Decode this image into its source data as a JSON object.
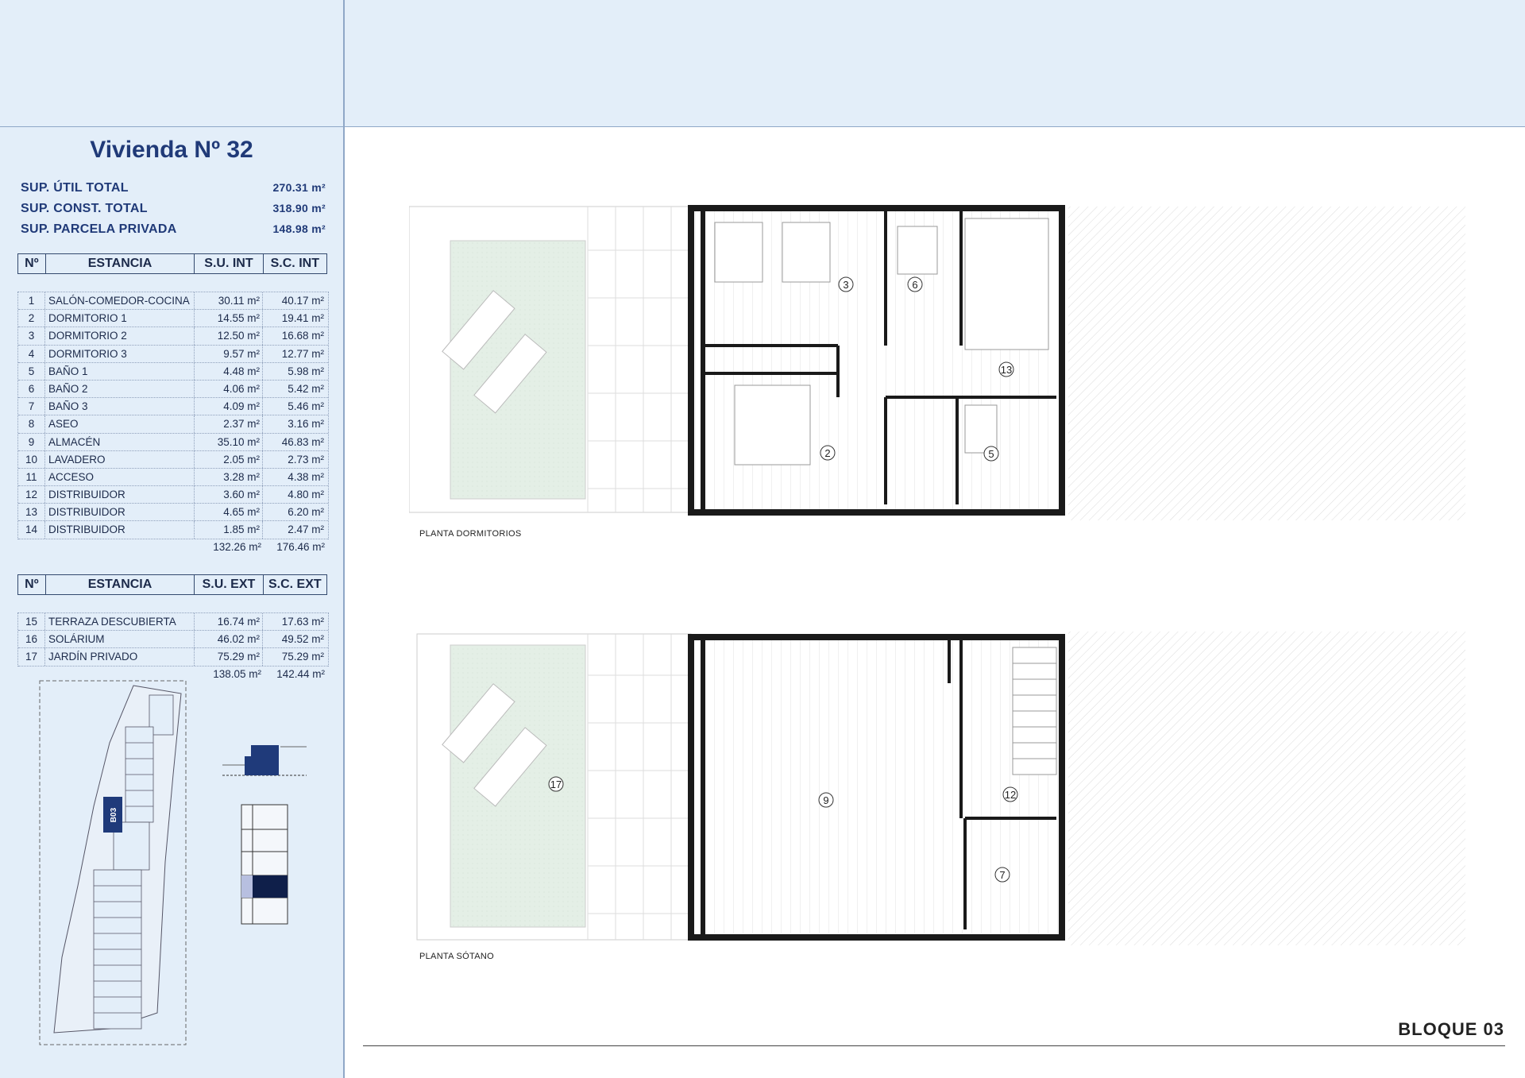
{
  "title": "Vivienda Nº 32",
  "summary": [
    {
      "label": "SUP. ÚTIL TOTAL",
      "value": "270.31 m²"
    },
    {
      "label": "SUP. CONST. TOTAL",
      "value": "318.90 m²"
    },
    {
      "label": "SUP. PARCELA PRIVADA",
      "value": "148.98 m²"
    }
  ],
  "int_table": {
    "headers": [
      "Nº",
      "ESTANCIA",
      "S.U. INT",
      "S.C. INT"
    ],
    "rows": [
      {
        "n": "1",
        "name": "SALÓN-COMEDOR-COCINA",
        "su": "30.11 m²",
        "sc": "40.17 m²"
      },
      {
        "n": "2",
        "name": "DORMITORIO 1",
        "su": "14.55 m²",
        "sc": "19.41 m²"
      },
      {
        "n": "3",
        "name": "DORMITORIO 2",
        "su": "12.50 m²",
        "sc": "16.68 m²"
      },
      {
        "n": "4",
        "name": "DORMITORIO 3",
        "su": "9.57 m²",
        "sc": "12.77 m²"
      },
      {
        "n": "5",
        "name": "BAÑO 1",
        "su": "4.48 m²",
        "sc": "5.98 m²"
      },
      {
        "n": "6",
        "name": "BAÑO 2",
        "su": "4.06 m²",
        "sc": "5.42 m²"
      },
      {
        "n": "7",
        "name": "BAÑO 3",
        "su": "4.09 m²",
        "sc": "5.46 m²"
      },
      {
        "n": "8",
        "name": "ASEO",
        "su": "2.37 m²",
        "sc": "3.16 m²"
      },
      {
        "n": "9",
        "name": "ALMACÉN",
        "su": "35.10 m²",
        "sc": "46.83 m²"
      },
      {
        "n": "10",
        "name": "LAVADERO",
        "su": "2.05 m²",
        "sc": "2.73 m²"
      },
      {
        "n": "11",
        "name": "ACCESO",
        "su": "3.28 m²",
        "sc": "4.38 m²"
      },
      {
        "n": "12",
        "name": "DISTRIBUIDOR",
        "su": "3.60 m²",
        "sc": "4.80 m²"
      },
      {
        "n": "13",
        "name": "DISTRIBUIDOR",
        "su": "4.65 m²",
        "sc": "6.20 m²"
      },
      {
        "n": "14",
        "name": "DISTRIBUIDOR",
        "su": "1.85 m²",
        "sc": "2.47 m²"
      }
    ],
    "total_su": "132.26 m²",
    "total_sc": "176.46 m²"
  },
  "ext_table": {
    "headers": [
      "Nº",
      "ESTANCIA",
      "S.U. EXT",
      "S.C. EXT"
    ],
    "rows": [
      {
        "n": "15",
        "name": "TERRAZA DESCUBIERTA",
        "su": "16.74 m²",
        "sc": "17.63 m²"
      },
      {
        "n": "16",
        "name": "SOLÁRIUM",
        "su": "46.02 m²",
        "sc": "49.52 m²"
      },
      {
        "n": "17",
        "name": "JARDÍN PRIVADO",
        "su": "75.29 m²",
        "sc": "75.29 m²"
      }
    ],
    "total_su": "138.05 m²",
    "total_sc": "142.44 m²"
  },
  "site_plan": {
    "block_label": "B03"
  },
  "plans": {
    "upper_label": "PLANTA DORMITORIOS",
    "lower_label": "PLANTA SÓTANO",
    "upper_rooms": [
      "3",
      "6",
      "13",
      "2",
      "5"
    ],
    "lower_rooms": [
      "17",
      "9",
      "12",
      "7"
    ]
  },
  "block_title": "BLOQUE 03",
  "colors": {
    "accent": "#203a78",
    "sidebar_bg": "#e3eef9",
    "garden": "#e4efe6",
    "wall": "#1a1a1a"
  }
}
